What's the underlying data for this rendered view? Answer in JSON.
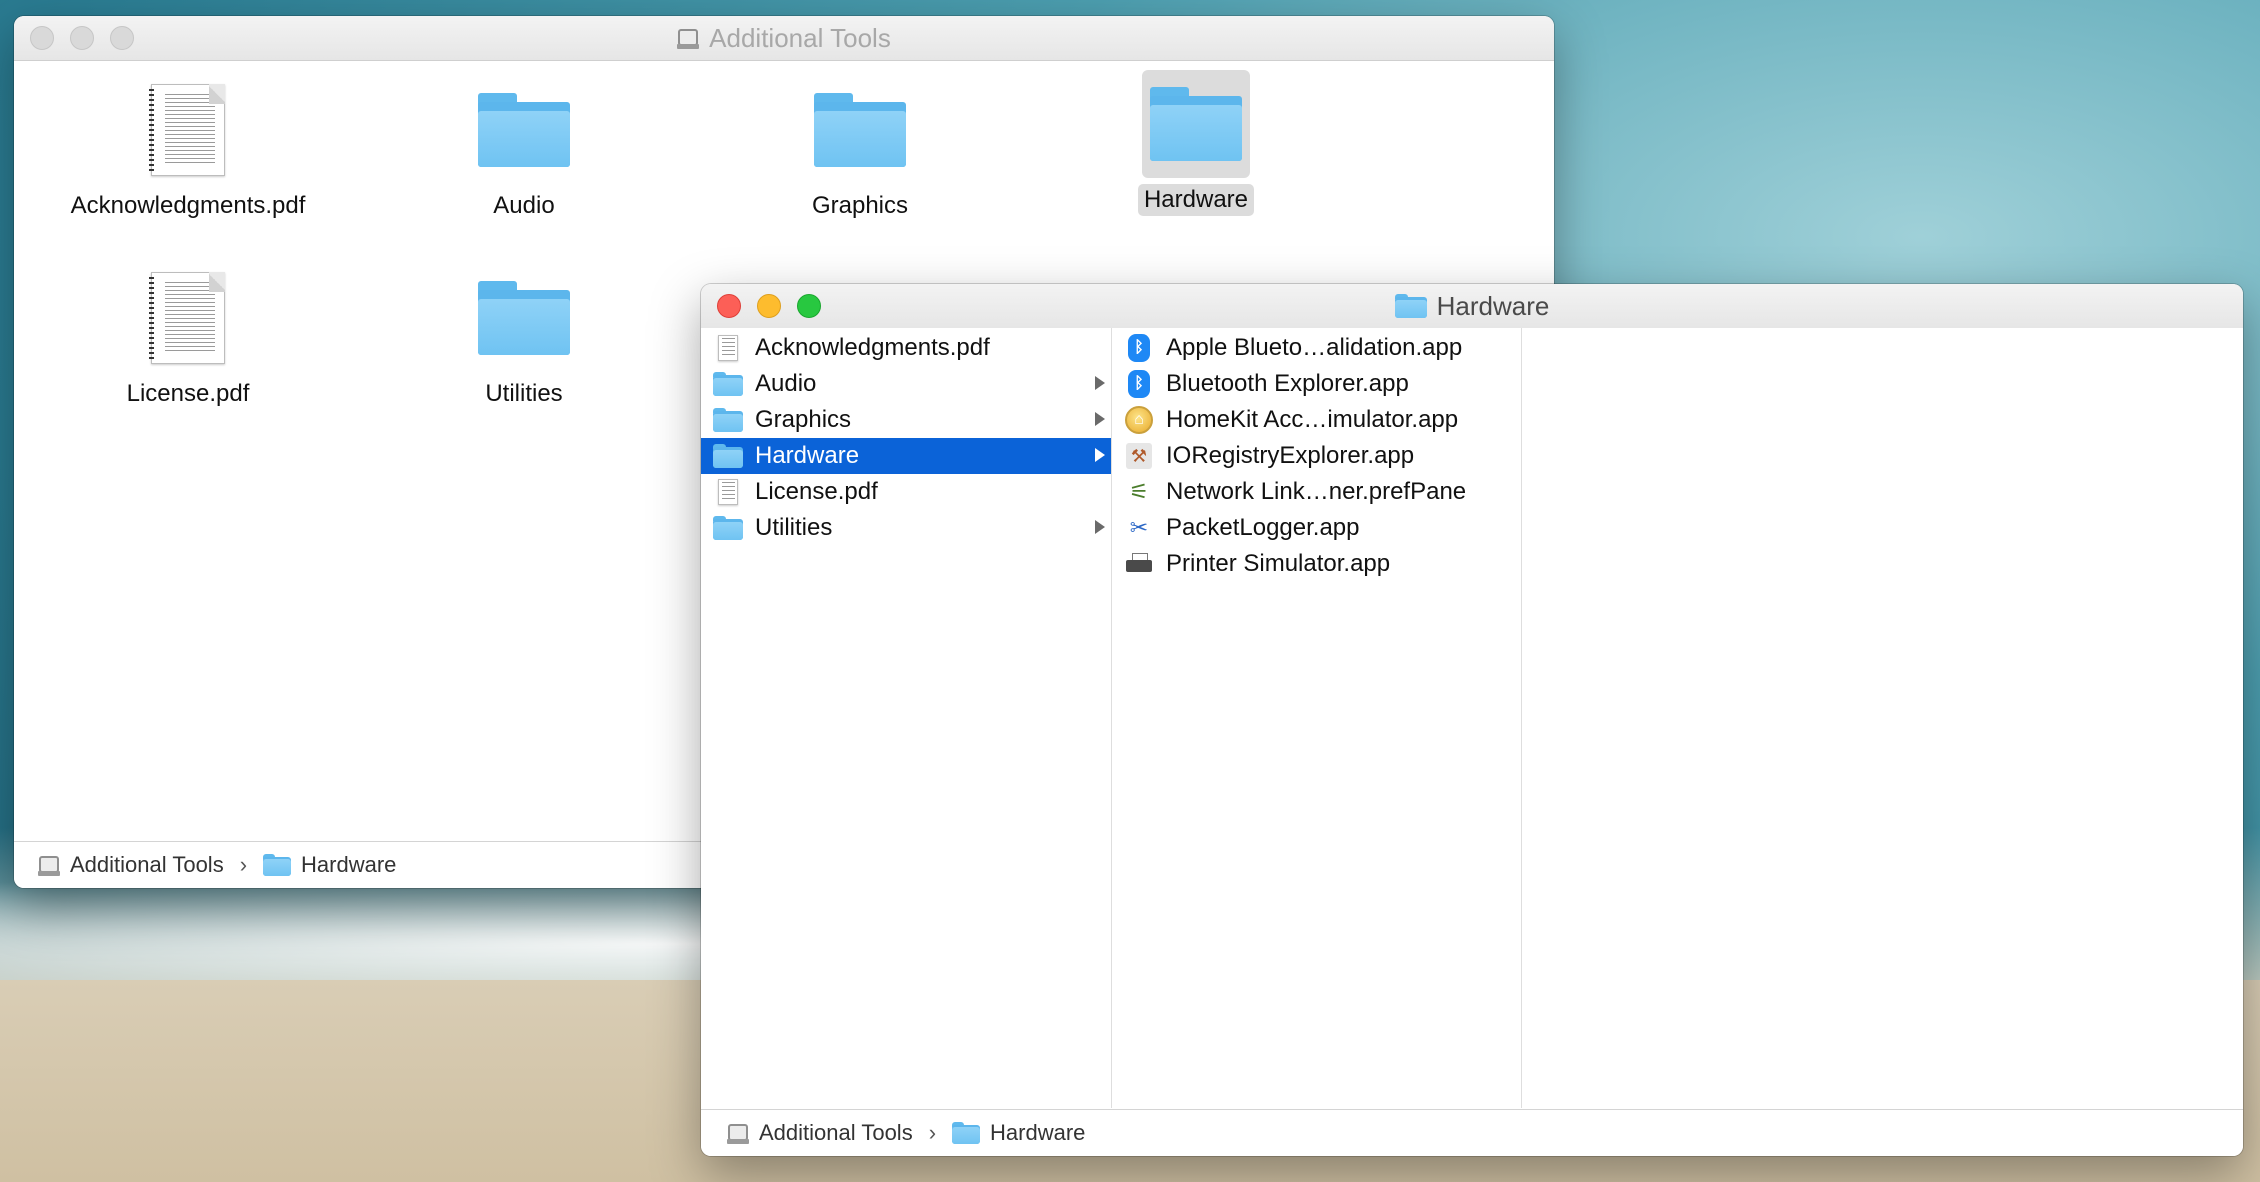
{
  "back_window": {
    "title": "Additional Tools",
    "items": [
      {
        "label": "Acknowledgments.pdf",
        "kind": "pdf"
      },
      {
        "label": "Audio",
        "kind": "folder"
      },
      {
        "label": "Graphics",
        "kind": "folder"
      },
      {
        "label": "Hardware",
        "kind": "folder",
        "selected": true
      },
      {
        "label": "License.pdf",
        "kind": "pdf"
      },
      {
        "label": "Utilities",
        "kind": "folder"
      }
    ],
    "path": [
      "Additional Tools",
      "Hardware"
    ]
  },
  "front_window": {
    "title": "Hardware",
    "column1": [
      {
        "label": "Acknowledgments.pdf",
        "kind": "pdf"
      },
      {
        "label": "Audio",
        "kind": "folder"
      },
      {
        "label": "Graphics",
        "kind": "folder"
      },
      {
        "label": "Hardware",
        "kind": "folder",
        "selected": true
      },
      {
        "label": "License.pdf",
        "kind": "pdf"
      },
      {
        "label": "Utilities",
        "kind": "folder"
      }
    ],
    "column2": [
      {
        "label": "Apple Blueto…alidation.app",
        "icon": "bluetooth-icon"
      },
      {
        "label": "Bluetooth Explorer.app",
        "icon": "bluetooth-icon"
      },
      {
        "label": "HomeKit Acc…imulator.app",
        "icon": "homekit-icon"
      },
      {
        "label": "IORegistryExplorer.app",
        "icon": "ioregistry-icon"
      },
      {
        "label": "Network Link…ner.prefPane",
        "icon": "network-link-icon"
      },
      {
        "label": "PacketLogger.app",
        "icon": "packetlogger-icon"
      },
      {
        "label": "Printer Simulator.app",
        "icon": "printer-icon"
      }
    ],
    "path": [
      "Additional Tools",
      "Hardware"
    ]
  },
  "colors": {
    "selection": "#0b63d8",
    "folder": "#6fc3f2",
    "close": "#fc5f57",
    "minimize": "#fdbc2e",
    "zoom": "#28c840"
  }
}
